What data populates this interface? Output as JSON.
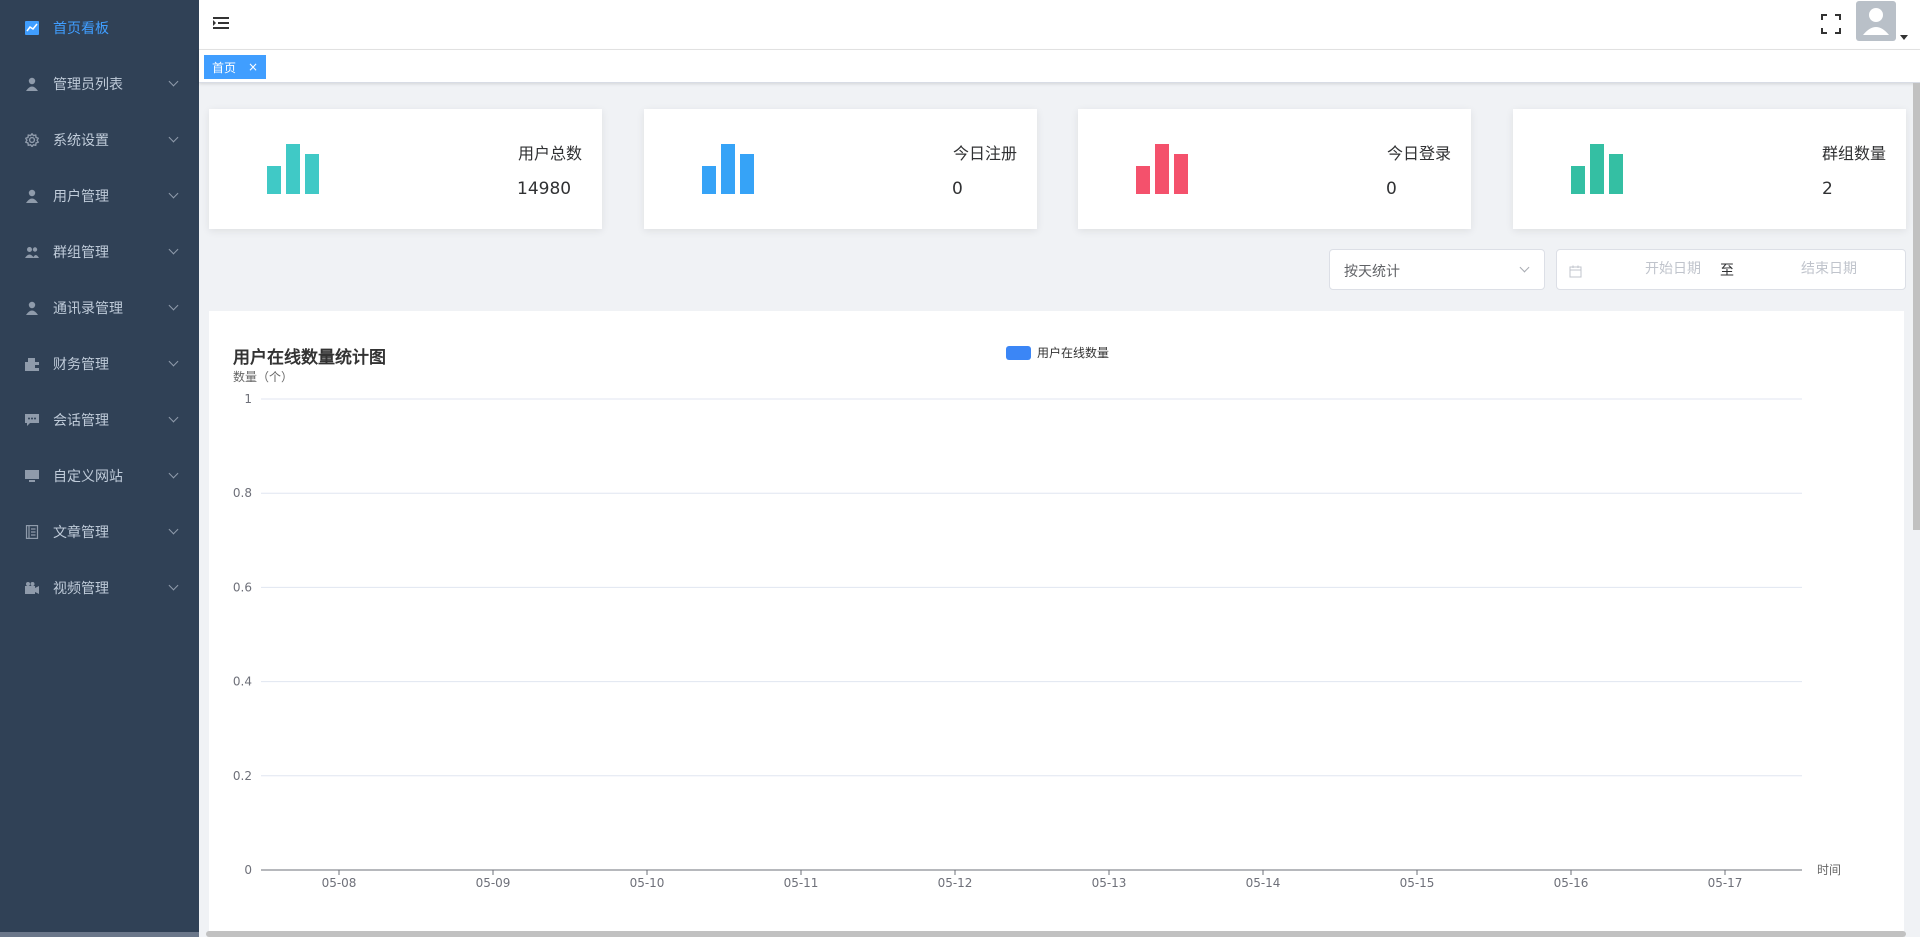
{
  "sidebar": {
    "items": [
      {
        "label": "首页看板",
        "icon": "chart-icon",
        "active": true
      },
      {
        "label": "管理员列表",
        "icon": "user-icon"
      },
      {
        "label": "系统设置",
        "icon": "gear-icon"
      },
      {
        "label": "用户管理",
        "icon": "user-icon"
      },
      {
        "label": "群组管理",
        "icon": "group-icon"
      },
      {
        "label": "通讯录管理",
        "icon": "user-icon"
      },
      {
        "label": "财务管理",
        "icon": "wallet-icon"
      },
      {
        "label": "会话管理",
        "icon": "chat-icon"
      },
      {
        "label": "自定义网站",
        "icon": "monitor-icon"
      },
      {
        "label": "文章管理",
        "icon": "document-icon"
      },
      {
        "label": "视频管理",
        "icon": "video-icon"
      }
    ]
  },
  "tags": [
    {
      "label": "首页",
      "close": "×"
    }
  ],
  "cards": [
    {
      "title": "用户总数",
      "value": "14980",
      "color": "#40c9c6"
    },
    {
      "title": "今日注册",
      "value": "0",
      "color": "#36a3f7"
    },
    {
      "title": "今日登录",
      "value": "0",
      "color": "#f4516c"
    },
    {
      "title": "群组数量",
      "value": "2",
      "color": "#34bfa3"
    }
  ],
  "filters": {
    "mode": "按天统计",
    "start_placeholder": "开始日期",
    "separator": "至",
    "end_placeholder": "结束日期"
  },
  "chart": {
    "title": "用户在线数量统计图"
  },
  "chart_data": {
    "type": "line",
    "title": "用户在线数量统计图",
    "xlabel": "时间",
    "ylabel": "数量（个）",
    "categories": [
      "05-08",
      "05-09",
      "05-10",
      "05-11",
      "05-12",
      "05-13",
      "05-14",
      "05-15",
      "05-16",
      "05-17"
    ],
    "y_ticks": [
      "0",
      "0.2",
      "0.4",
      "0.6",
      "0.8",
      "1"
    ],
    "ylim": [
      0,
      1
    ],
    "series": [
      {
        "name": "用户在线数量",
        "values": [],
        "color": "#3b86f6"
      }
    ],
    "legend": "top-center",
    "grid": true
  }
}
